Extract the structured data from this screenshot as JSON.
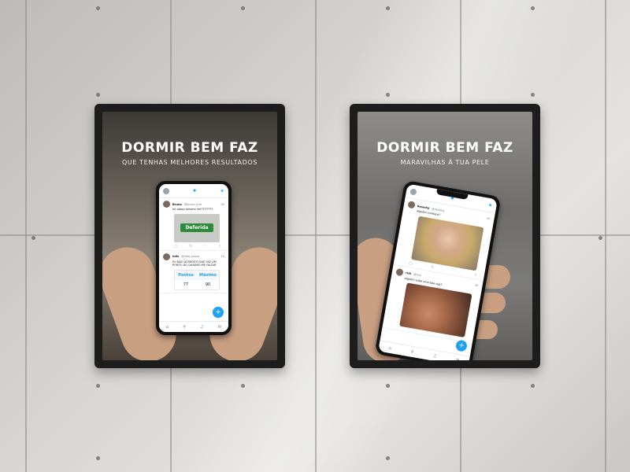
{
  "posters": [
    {
      "headline": "DORMIR BEM FAZ",
      "subline": "QUE TENHAS MELHORES RESULTADOS",
      "tweets": [
        {
          "name": "Bruno",
          "handle": "@bruno_krm",
          "time": "2h",
          "text": "eu posso mesmo ver????????"
        },
        {
          "name": "Inês",
          "handle": "@ines_sousa",
          "time": "1h",
          "text": "EU NÃO ACREDITO QUE FAZ UM PONTO DO QUADRO ME FALTAR"
        }
      ],
      "badge": "Deferida",
      "score_headers": [
        "Pontos",
        "Máximo"
      ],
      "score_values": [
        "77",
        "90"
      ]
    },
    {
      "headline": "DORMIR BEM FAZ",
      "subline": "MARAVILHAS À TUA PELE",
      "tweets": [
        {
          "name": "Rosinha",
          "handle": "@rosinha",
          "time": "1h",
          "text": "alguém conhece?"
        },
        {
          "name": "rick",
          "handle": "@rick",
          "time": "2h",
          "text": "alguém sabe uma boa loja?"
        }
      ]
    }
  ],
  "icons": {
    "bird": "twitter-bird-icon",
    "spark": "sparkle-icon",
    "fab": "compose-tweet-icon",
    "nav": [
      "home-icon",
      "search-icon",
      "bell-icon",
      "mail-icon"
    ]
  },
  "colors": {
    "twitter_blue": "#1da1f2",
    "badge_green": "#2e8b3c"
  }
}
